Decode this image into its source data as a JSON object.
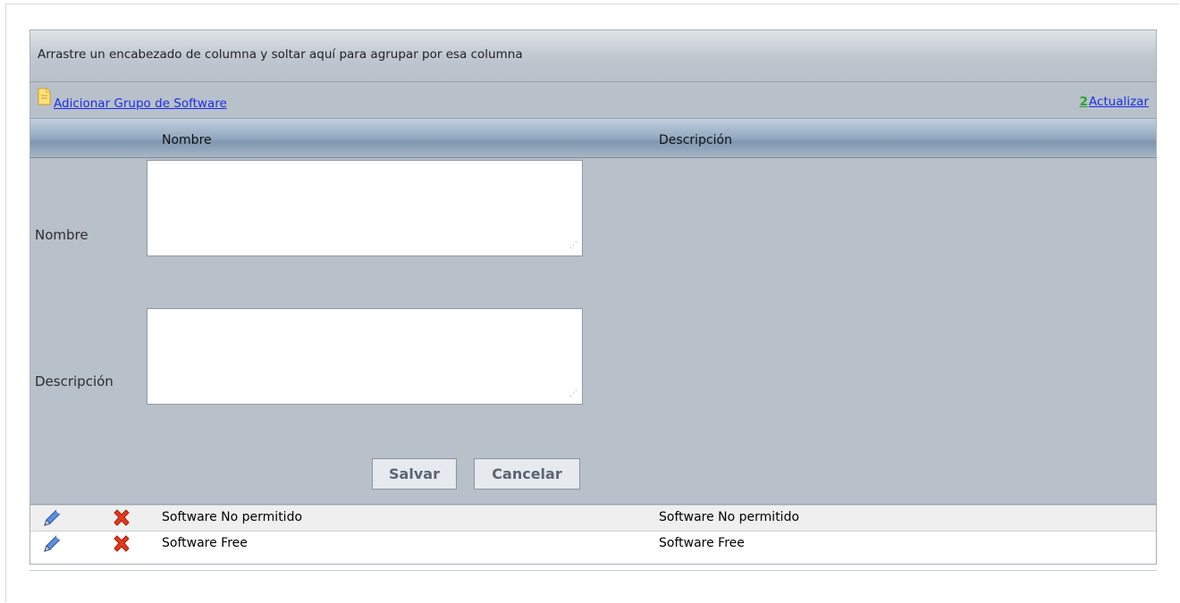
{
  "grid": {
    "group_panel_hint": "Arrastre un encabezado de columna y soltar aquí para agrupar por esa columna",
    "commands": {
      "add_label": "Adicionar Grupo de Software",
      "add_icon": "new-document-icon",
      "refresh_label": "Actualizar",
      "refresh_icon": "refresh-icon"
    },
    "columns": [
      "Nombre",
      "Descripción"
    ],
    "edit_form": {
      "name_label": "Nombre",
      "name_value": "",
      "description_label": "Descripción",
      "description_value": "",
      "save_label": "Salvar",
      "cancel_label": "Cancelar"
    },
    "rows": [
      {
        "nombre": "Software No permitido",
        "descripcion": "Software No permitido",
        "edit_icon": "pencil-icon",
        "delete_icon": "red-x-icon"
      },
      {
        "nombre": "Software Free",
        "descripcion": "Software Free",
        "edit_icon": "pencil-icon",
        "delete_icon": "red-x-icon"
      }
    ]
  },
  "colors": {
    "grid_background": "#b8c0ca",
    "header_gradient_mid": "#93a9c0",
    "link": "#1a2ee6",
    "refresh_icon": "#2aa52a",
    "delete_icon": "#e23a1a",
    "edit_icon": "#3a6fc7"
  }
}
